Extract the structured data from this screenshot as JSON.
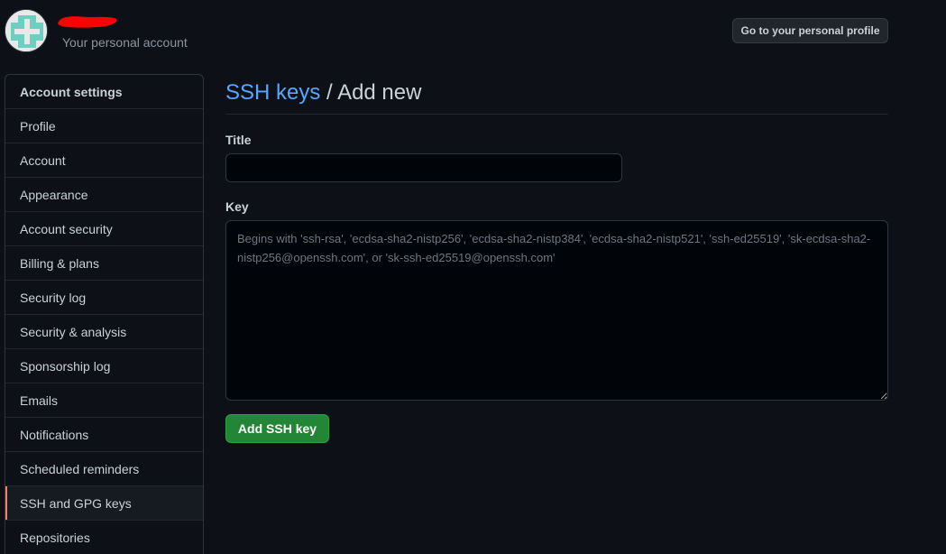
{
  "header": {
    "account_subtitle": "Your personal account",
    "profile_button_label": "Go to your personal profile"
  },
  "sidebar": {
    "heading": "Account settings",
    "items": [
      {
        "label": "Profile"
      },
      {
        "label": "Account"
      },
      {
        "label": "Appearance"
      },
      {
        "label": "Account security"
      },
      {
        "label": "Billing & plans"
      },
      {
        "label": "Security log"
      },
      {
        "label": "Security & analysis"
      },
      {
        "label": "Sponsorship log"
      },
      {
        "label": "Emails"
      },
      {
        "label": "Notifications"
      },
      {
        "label": "Scheduled reminders"
      },
      {
        "label": "SSH and GPG keys"
      },
      {
        "label": "Repositories"
      }
    ],
    "selected": "SSH and GPG keys"
  },
  "main": {
    "breadcrumb_link": "SSH keys",
    "breadcrumb_separator": " / ",
    "breadcrumb_current": "Add new",
    "title_label": "Title",
    "title_value": "",
    "key_label": "Key",
    "key_value": "",
    "key_placeholder": "Begins with 'ssh-rsa', 'ecdsa-sha2-nistp256', 'ecdsa-sha2-nistp384', 'ecdsa-sha2-nistp521', 'ssh-ed25519', 'sk-ecdsa-sha2-nistp256@openssh.com', or 'sk-ssh-ed25519@openssh.com'",
    "submit_label": "Add SSH key"
  },
  "colors": {
    "background": "#0d1117",
    "accent_link": "#58a6ff",
    "primary_button": "#238636",
    "selected_indicator": "#f78166",
    "redaction": "#ff0000"
  }
}
